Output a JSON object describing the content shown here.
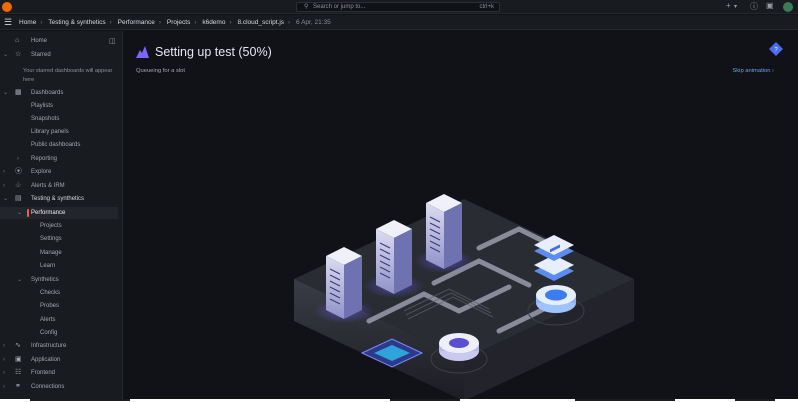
{
  "topbar": {
    "search_placeholder": "Search or jump to...",
    "search_shortcut": "ctrl+k",
    "icons": [
      "grafana-logo-icon",
      "search-icon",
      "plus-icon",
      "help-icon",
      "news-icon",
      "avatar"
    ]
  },
  "breadcrumb": {
    "items": [
      "Home",
      "Testing & synthetics",
      "Performance",
      "Projects",
      "k6demo",
      "8.cloud_script.js"
    ],
    "date": "6 Apr, 21:35"
  },
  "sidebar": {
    "starred_note": "Your starred dashboards will appear here",
    "items": [
      {
        "label": "Home",
        "icon": "home-icon"
      },
      {
        "label": "Starred",
        "icon": "star-icon"
      },
      {
        "label": "Dashboards",
        "icon": "dashboards-icon"
      },
      {
        "label": "Playlists"
      },
      {
        "label": "Snapshots"
      },
      {
        "label": "Library panels"
      },
      {
        "label": "Public dashboards"
      },
      {
        "label": "Reporting"
      },
      {
        "label": "Explore",
        "icon": "compass-icon"
      },
      {
        "label": "Alerts & IRM",
        "icon": "bell-icon"
      },
      {
        "label": "Testing & synthetics",
        "icon": "chart-icon"
      },
      {
        "label": "Performance"
      },
      {
        "label": "Projects"
      },
      {
        "label": "Settings"
      },
      {
        "label": "Manage"
      },
      {
        "label": "Learn"
      },
      {
        "label": "Synthetics"
      },
      {
        "label": "Checks"
      },
      {
        "label": "Probes"
      },
      {
        "label": "Alerts"
      },
      {
        "label": "Config"
      },
      {
        "label": "Infrastructure",
        "icon": "infrastructure-icon"
      },
      {
        "label": "Application",
        "icon": "application-icon"
      },
      {
        "label": "Frontend",
        "icon": "frontend-icon"
      },
      {
        "label": "Connections",
        "icon": "connections-icon"
      }
    ]
  },
  "main": {
    "title": "Setting up test (50%)",
    "progress_percent": 50,
    "status": "Queueing for a slot",
    "skip_label": "Skip animation ›"
  },
  "colors": {
    "background": "#111217",
    "panel": "#181b1f",
    "accent": "#f55f3e",
    "link": "#6e9fff",
    "brand": "#7d64ff"
  }
}
